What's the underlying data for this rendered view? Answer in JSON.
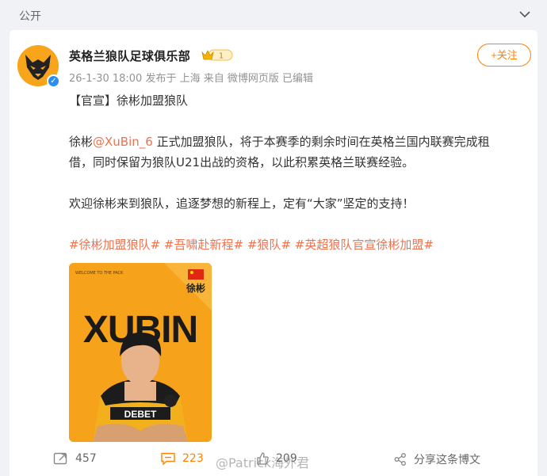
{
  "topbar": {
    "visibility": "公开"
  },
  "post": {
    "author": "英格兰狼队足球俱乐部",
    "vip_level": "1",
    "meta": "26-1-30 18:00  发布于 上海  来自 微博网页版  已编辑",
    "follow_label": "+关注",
    "title": "【官宣】徐彬加盟狼队",
    "para1_prefix": "徐彬",
    "mention": "@XuBin_6",
    "para1_line1_rest": " 正式加盟狼队，将于本赛季的剩余时间在英格兰国内联赛完成租",
    "para1_line2": "借，同时保留为狼队U21出战的资格，以此积累英格兰联赛经验。",
    "para2": "欢迎徐彬来到狼队，追逐梦想的新程上，定有“大家”坚定的支持！",
    "tags": [
      "#徐彬加盟狼队#",
      "#吾啸赴新程#",
      "#狼队#",
      "#英超狼队官宣徐彬加盟#"
    ]
  },
  "poster": {
    "welcome_text": "WELCOME TO THE PACK",
    "player_name_cn": "徐彬",
    "big_name": "XUBIN",
    "shirt_text": "DEBET"
  },
  "actions": {
    "share_count": "457",
    "comment_count": "223",
    "like_count": "209",
    "forward_label": "分享这条博文"
  },
  "watermark": "@Patrick海外君",
  "colors": {
    "accent": "#ff8200",
    "link": "#eb7350",
    "wolves_gold": "#f7a21b"
  }
}
